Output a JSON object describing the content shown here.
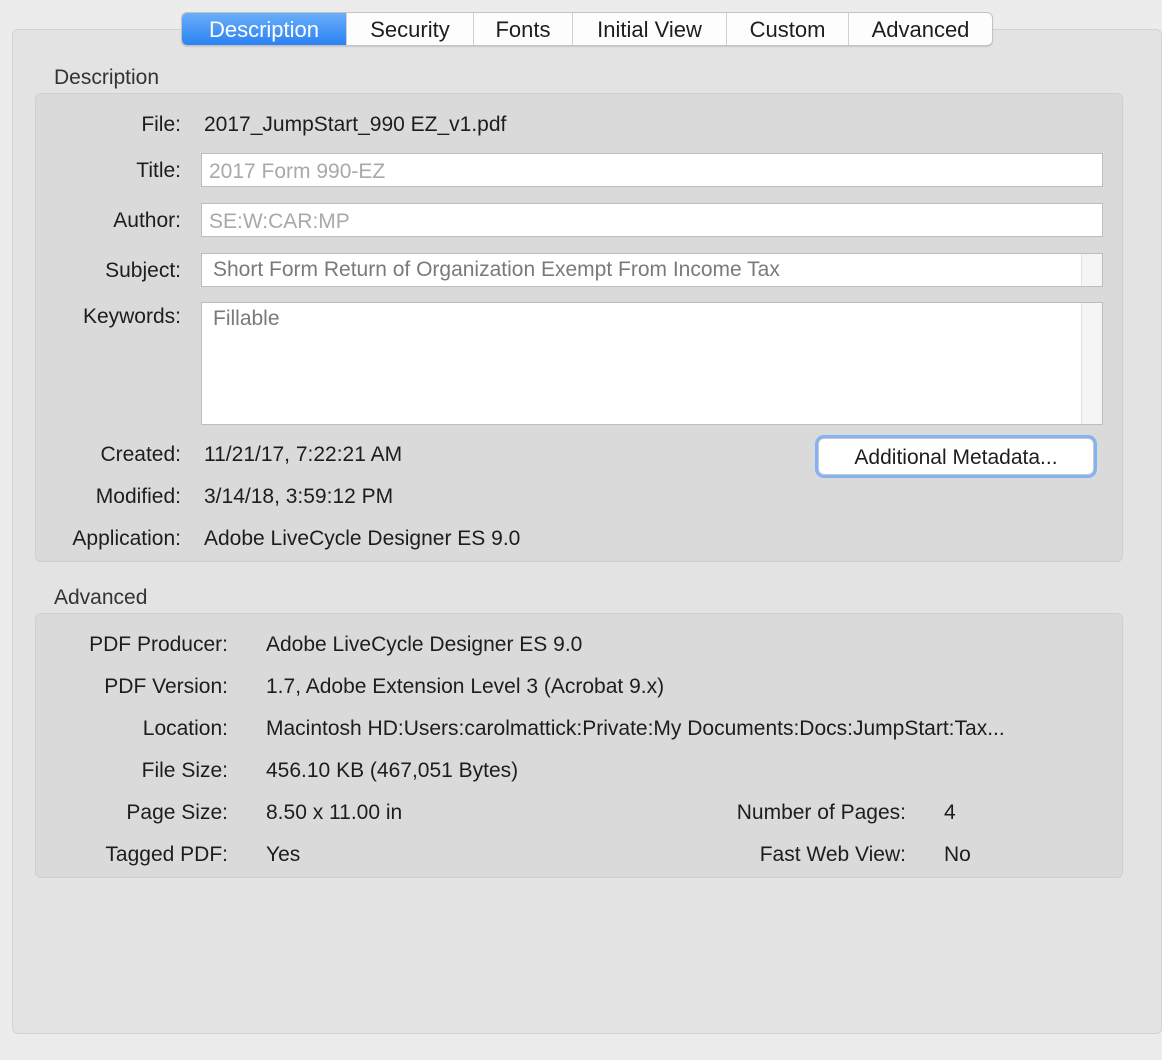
{
  "tabs": [
    "Description",
    "Security",
    "Fonts",
    "Initial View",
    "Custom",
    "Advanced"
  ],
  "active_tab": "Description",
  "description": {
    "title": "Description",
    "file_label": "File:",
    "file_value": "2017_JumpStart_990 EZ_v1.pdf",
    "title_label": "Title:",
    "title_value": "2017 Form 990-EZ",
    "author_label": "Author:",
    "author_value": "SE:W:CAR:MP",
    "subject_label": "Subject:",
    "subject_value": "Short Form Return of Organization Exempt From Income Tax",
    "keywords_label": "Keywords:",
    "keywords_value": "Fillable",
    "created_label": "Created:",
    "created_value": "11/21/17, 7:22:21 AM",
    "modified_label": "Modified:",
    "modified_value": "3/14/18, 3:59:12 PM",
    "application_label": "Application:",
    "application_value": "Adobe LiveCycle Designer ES 9.0",
    "metadata_button": "Additional Metadata..."
  },
  "advanced": {
    "title": "Advanced",
    "producer_label": "PDF Producer:",
    "producer_value": "Adobe LiveCycle Designer ES 9.0",
    "version_label": "PDF Version:",
    "version_value": "1.7, Adobe Extension Level 3 (Acrobat 9.x)",
    "location_label": "Location:",
    "location_value": "Macintosh HD:Users:carolmattick:Private:My Documents:Docs:JumpStart:Tax...",
    "filesize_label": "File Size:",
    "filesize_value": "456.10 KB (467,051 Bytes)",
    "pagesize_label": "Page Size:",
    "pagesize_value": "8.50 x 11.00 in",
    "numpages_label": "Number of Pages:",
    "numpages_value": "4",
    "tagged_label": "Tagged PDF:",
    "tagged_value": "Yes",
    "fastweb_label": "Fast Web View:",
    "fastweb_value": "No"
  }
}
